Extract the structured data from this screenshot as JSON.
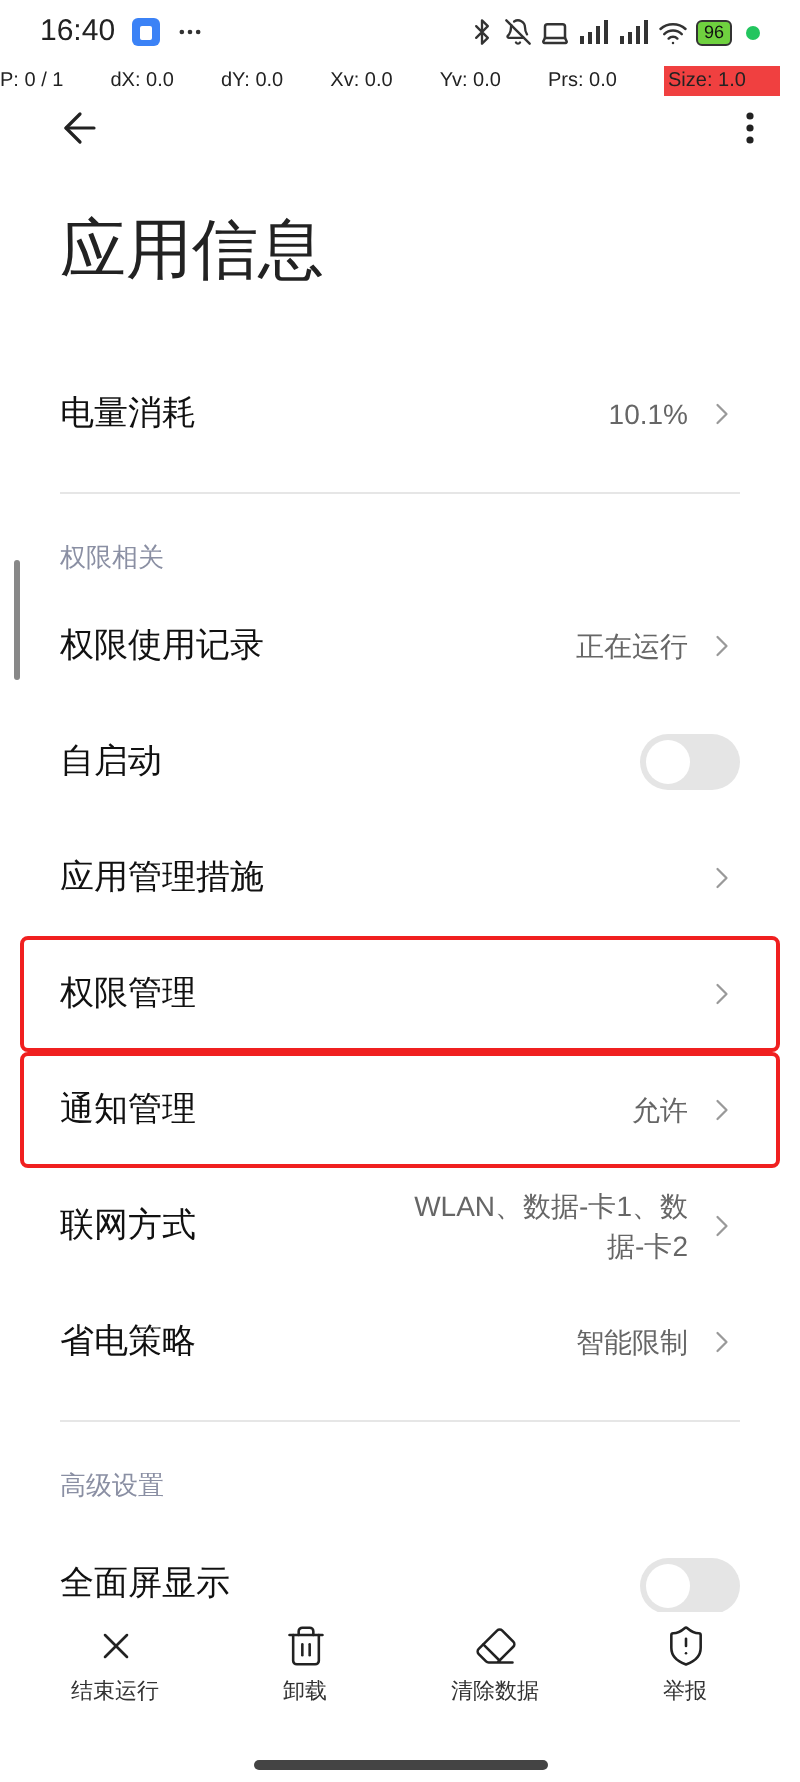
{
  "status_bar": {
    "time": "16:40",
    "battery": "96"
  },
  "debug_bar": [
    "P: 0 / 1",
    "dX: 0.0",
    "dY: 0.0",
    "Xv: 0.0",
    "Yv: 0.0",
    "Prs: 0.0",
    "Size: 1.0"
  ],
  "title": "应用信息",
  "sections": [
    {
      "rows": [
        {
          "kind": "chevron",
          "label": "电量消耗",
          "value": "10.1%",
          "highlighted": false
        }
      ]
    },
    {
      "header": "权限相关",
      "rows": [
        {
          "kind": "chevron",
          "label": "权限使用记录",
          "value": "正在运行",
          "highlighted": false
        },
        {
          "kind": "toggle",
          "label": "自启动",
          "on": false,
          "highlighted": false
        },
        {
          "kind": "chevron",
          "label": "应用管理措施",
          "highlighted": false
        },
        {
          "kind": "chevron",
          "label": "权限管理",
          "highlighted": true
        },
        {
          "kind": "chevron",
          "label": "通知管理",
          "value": "允许",
          "highlighted": true
        },
        {
          "kind": "chevron",
          "label": "联网方式",
          "value": "WLAN、数据-卡1、数据-卡2",
          "highlighted": false
        },
        {
          "kind": "chevron",
          "label": "省电策略",
          "value": "智能限制",
          "highlighted": false
        }
      ]
    },
    {
      "header": "高级设置",
      "rows": [
        {
          "kind": "toggle",
          "label": "全面屏显示",
          "on": false,
          "highlighted": false
        }
      ]
    }
  ],
  "bottom_actions": [
    {
      "kind": "close",
      "label": "结束运行"
    },
    {
      "kind": "trash",
      "label": "卸载"
    },
    {
      "kind": "eraser",
      "label": "清除数据"
    },
    {
      "kind": "report",
      "label": "举报"
    }
  ]
}
